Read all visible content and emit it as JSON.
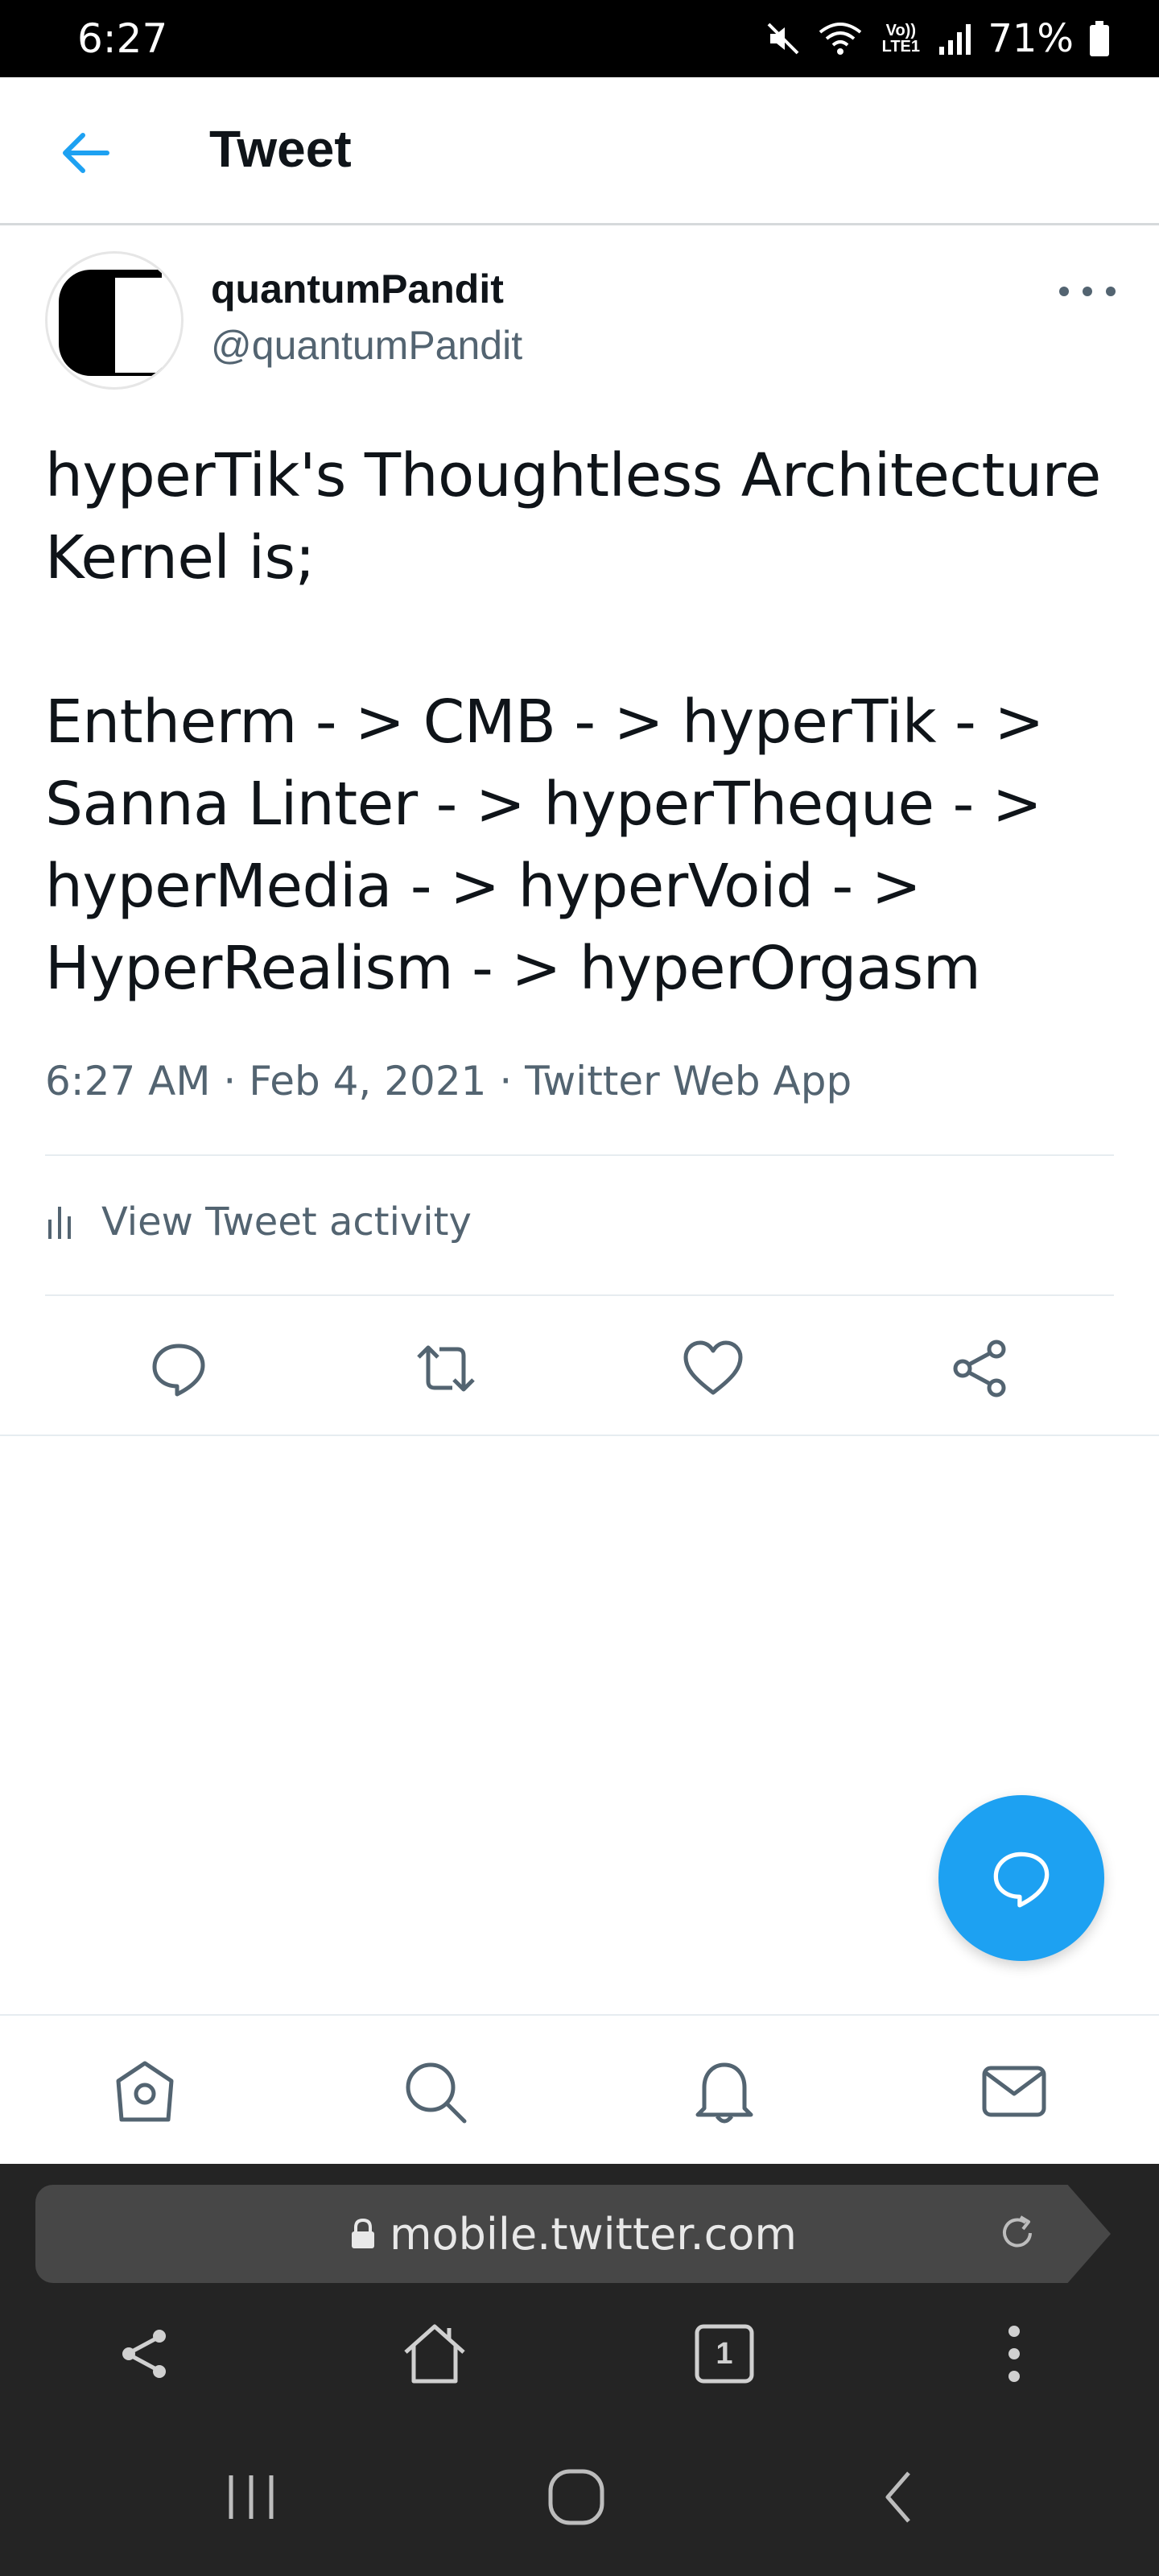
{
  "status_bar": {
    "time": "6:27",
    "network_label": "Vo)) LTE1",
    "battery": "71%"
  },
  "header": {
    "title": "Tweet",
    "back_icon": "arrow-left-icon"
  },
  "tweet": {
    "display_name": "quantumPandit",
    "handle": "@quantumPandit",
    "text": "hyperTik's Thoughtless Architecture Kernel is;\n\nEntherm - > CMB - > hyperTik - > Sanna Linter - > hyperTheque - > hyperMedia - > hyperVoid - > HyperRealism - > hyperOrgasm",
    "meta": "6:27 AM · Feb 4, 2021 · Twitter Web App",
    "activity_label": "View Tweet activity"
  },
  "actions": [
    "reply-icon",
    "retweet-icon",
    "like-icon",
    "share-icon"
  ],
  "tabs": [
    "home-icon",
    "search-icon",
    "notifications-icon",
    "messages-icon"
  ],
  "browser": {
    "url": "mobile.twitter.com",
    "tab_count": "1"
  },
  "colors": {
    "accent": "#1da1f2",
    "secondary_text": "#536471",
    "browser_bg": "#242424",
    "urlbar_bg": "#474747"
  }
}
